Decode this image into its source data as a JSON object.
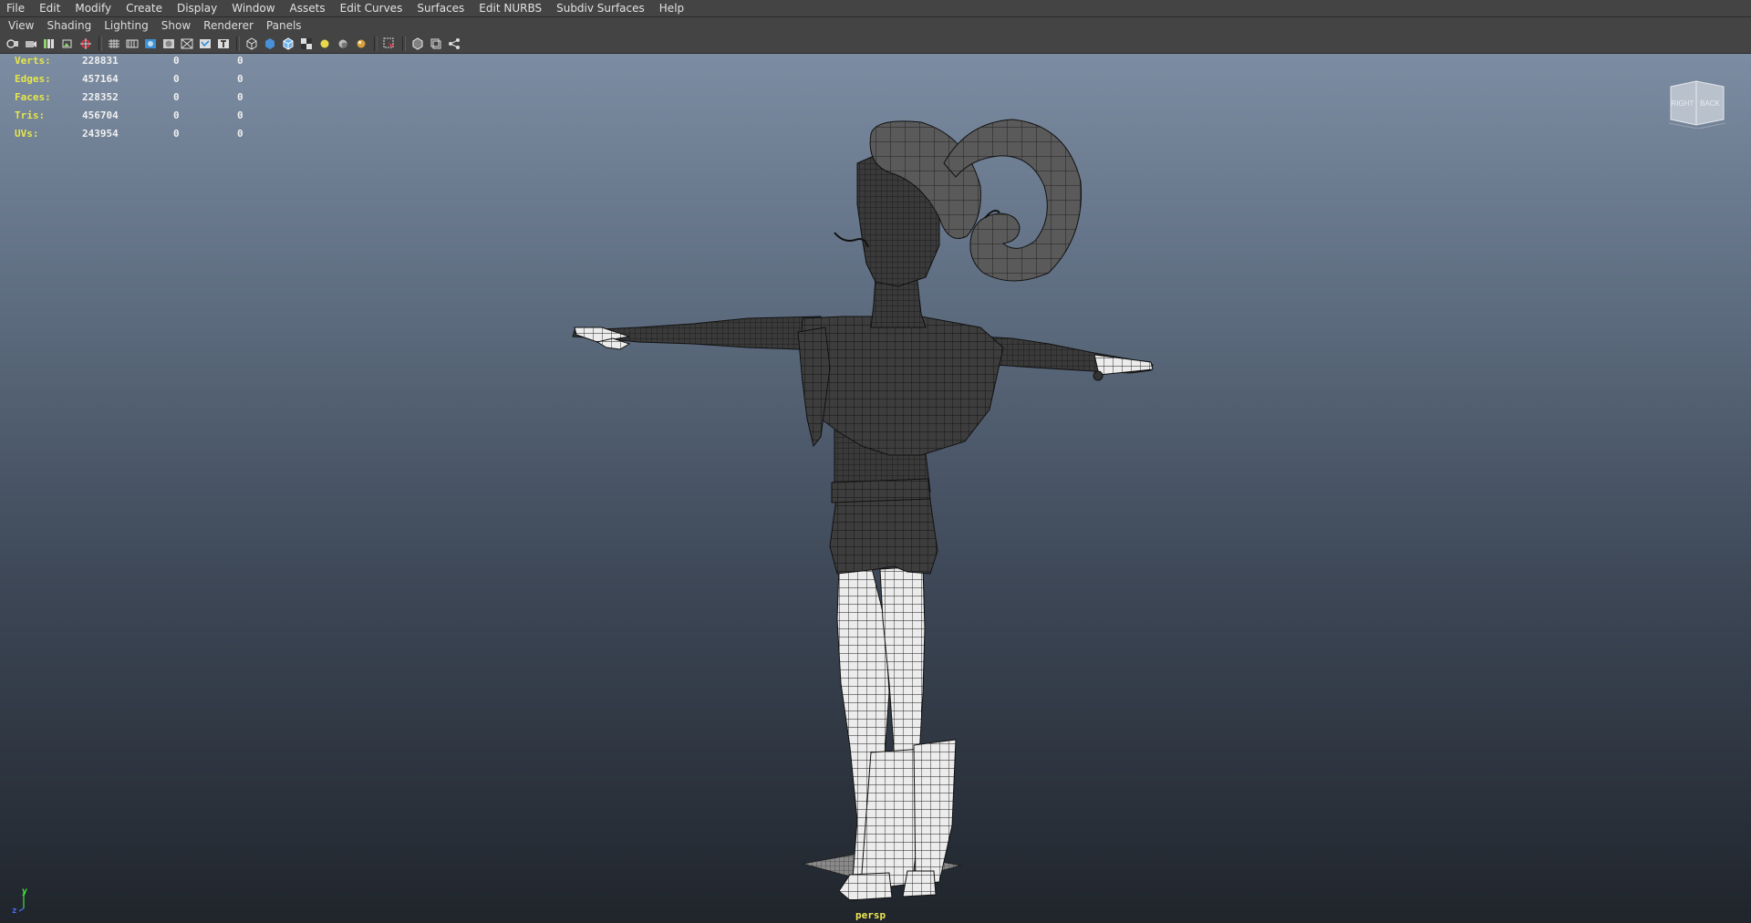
{
  "main_menu": [
    "File",
    "Edit",
    "Modify",
    "Create",
    "Display",
    "Window",
    "Assets",
    "Edit Curves",
    "Surfaces",
    "Edit NURBS",
    "Subdiv Surfaces",
    "Help"
  ],
  "panel_menu": [
    "View",
    "Shading",
    "Lighting",
    "Show",
    "Renderer",
    "Panels"
  ],
  "toolbar_icons": [
    "select-camera-icon",
    "camera-attributes-icon",
    "bookmarks-icon",
    "image-plane-icon",
    "snap-to-grid-icon",
    "grid-toggle-icon",
    "film-gate-icon",
    "resolution-gate-icon",
    "gate-mask-icon",
    "field-chart-icon",
    "safe-action-icon",
    "safe-title-icon",
    "wireframe-icon",
    "smooth-shade-icon",
    "wireframe-on-shaded-icon",
    "textured-icon",
    "default-light-icon",
    "shadows-icon",
    "ambient-occlusion-icon",
    "isolate-select-icon",
    "xray-icon",
    "xray-joints-icon",
    "camera-sequencer-icon"
  ],
  "hud": {
    "rows": [
      {
        "label": "Verts:",
        "a": "228831",
        "b": "0",
        "c": "0"
      },
      {
        "label": "Edges:",
        "a": "457164",
        "b": "0",
        "c": "0"
      },
      {
        "label": "Faces:",
        "a": "228352",
        "b": "0",
        "c": "0"
      },
      {
        "label": "Tris:",
        "a": "456704",
        "b": "0",
        "c": "0"
      },
      {
        "label": "UVs:",
        "a": "243954",
        "b": "0",
        "c": "0"
      }
    ]
  },
  "viewcube": {
    "right": "RIGHT",
    "back": "BACK"
  },
  "camera": "persp",
  "axis": {
    "y": "y",
    "z": "z"
  },
  "colors": {
    "hud_label": "#e6e64a",
    "hud_value": "#f0f0f0",
    "camera_label": "#f0e850",
    "mesh": "#3b3b3b",
    "mesh_light": "#e8e8e8"
  }
}
